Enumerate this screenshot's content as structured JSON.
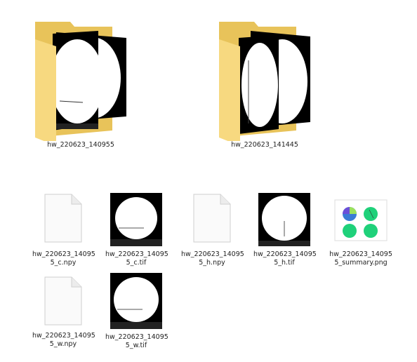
{
  "folders": [
    {
      "name": "hw_220623_140955",
      "icon": "folder-with-images-icon"
    },
    {
      "name": "hw_220623_141445",
      "icon": "folder-with-images-icon"
    }
  ],
  "files": [
    {
      "name": "hw_220623_140955_c.npy",
      "display": "hw_220623_14095\n5_c.npy",
      "icon": "blank-file-icon"
    },
    {
      "name": "hw_220623_140955_c.tif",
      "display": "hw_220623_14095\n5_c.tif",
      "icon": "tif-thumbnail-icon"
    },
    {
      "name": "hw_220623_140955_h.npy",
      "display": "hw_220623_14095\n5_h.npy",
      "icon": "blank-file-icon"
    },
    {
      "name": "hw_220623_140955_h.tif",
      "display": "hw_220623_14095\n5_h.tif",
      "icon": "tif-thumbnail-icon"
    },
    {
      "name": "hw_220623_140955_summary.png",
      "display": "hw_220623_14095\n5_summary.png",
      "icon": "png-thumbnail-icon"
    },
    {
      "name": "hw_220623_140955_w.npy",
      "display": "hw_220623_14095\n5_w.npy",
      "icon": "blank-file-icon"
    },
    {
      "name": "hw_220623_140955_w.tif",
      "display": "hw_220623_14095\n5_w.tif",
      "icon": "tif-thumbnail-icon"
    }
  ],
  "colors": {
    "folder_back": "#e8c35a",
    "folder_front": "#f7d980",
    "thumb_bg": "#000000"
  }
}
